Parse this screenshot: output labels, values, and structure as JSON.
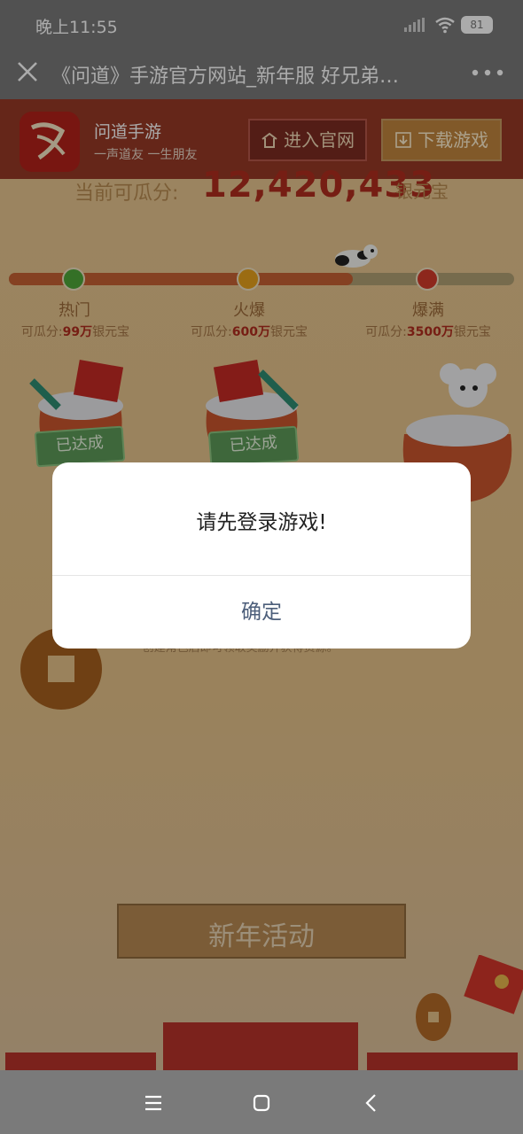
{
  "status_bar": {
    "time": "晚上11:55",
    "battery": "81"
  },
  "browser": {
    "title": "《问道》手游官方网站_新年服 好兄弟…"
  },
  "banner": {
    "app_name": "问道手游",
    "slogan": "一声道友 一生朋友",
    "enter_label": "进入官网",
    "download_label": "下载游戏"
  },
  "score": {
    "label": "当前可瓜分:",
    "value": "12,420,433",
    "unit": "银元宝"
  },
  "progress": {
    "fraction": 0.68
  },
  "tiers": [
    {
      "name": "热门",
      "pool_prefix": "可瓜分:",
      "pool_value": "99万",
      "pool_unit": "银元宝",
      "status": "已达成"
    },
    {
      "name": "火爆",
      "pool_prefix": "可瓜分:",
      "pool_value": "600万",
      "pool_unit": "银元宝",
      "status": "已达成"
    },
    {
      "name": "爆满",
      "pool_prefix": "可瓜分:",
      "pool_value": "3500万",
      "pool_unit": "银元宝",
      "status": ""
    }
  ],
  "hint": "* 创建角色后即可领取奖励并获得资源。",
  "section_title": "新年活动",
  "dialog": {
    "message": "请先登录游戏!",
    "confirm": "确定"
  },
  "colors": {
    "accent_red": "#b12d1f",
    "dialog_button": "#4c5e7a",
    "overlay": "rgba(0,0,0,0.33)"
  },
  "icons": [
    "close-icon",
    "more-icon",
    "wifi-icon",
    "signal-icon",
    "battery-icon",
    "home-icon",
    "download-icon",
    "menu-icon",
    "square-icon",
    "back-icon"
  ]
}
